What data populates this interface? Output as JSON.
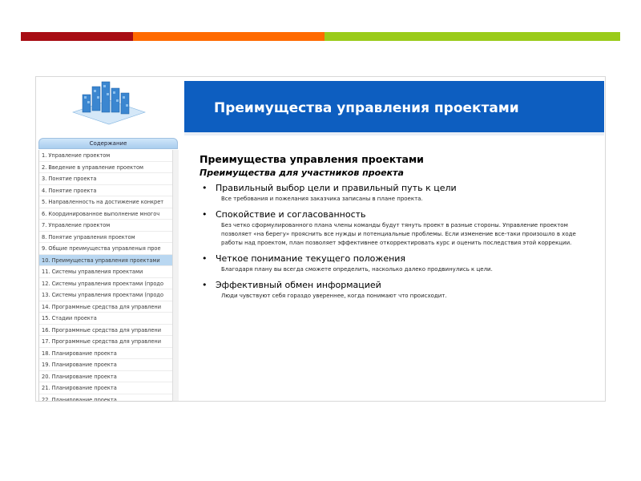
{
  "stripe_colors": [
    "#a80d14",
    "#ff6a00",
    "#9acb1a"
  ],
  "sidebar": {
    "toc_title": "Содержание",
    "items": [
      "1. Управление проектом",
      "2. Введение в управление проектом",
      "3. Понятие проекта",
      "4. Понятие проекта",
      "5. Направленность на достижение конкрет",
      "6. Координированное выполнение многоч",
      "7. Управление проектом",
      "8. Понятие управления проектом",
      "9. Общие преимущества управленыя прое",
      "10. Преимущества управления проектами",
      "11. Системы управления проектами",
      "12. Системы управления проектами (продо",
      "13. Системы управления проектами (продо",
      "14. Программные средства для управлени",
      "15. Стадии проекта",
      "16. Программные средства для управлени",
      "17. Программные средства для управлени",
      "18. Планирование проекта",
      "19. Планирование проекта",
      "20. Планирование проекта",
      "21. Планирование проекта",
      "22. Планирование проекта"
    ],
    "active_index": 9
  },
  "main": {
    "banner_title": "Преимущества управления проектами",
    "content_title": "Преимущества управления проектами",
    "content_subtitle": "Преимущества для участников проекта",
    "bullets": [
      {
        "title": "Правильный выбор цели и правильный путь к цели",
        "text": "Все требования и пожелания заказчика записаны в плане проекта."
      },
      {
        "title": "Спокойствие и согласованность",
        "text": "Без четко сформулированного плана члены команды будут тянуть проект в разные стороны. Управление проектом позволяет «на берегу» прояснить все нужды и потенциальные проблемы. Если изменение все-таки произошло в ходе работы над проектом, план позволяет эффективнее откорректировать курс и оценить последствия этой коррекции."
      },
      {
        "title": "Четкое понимание текущего положения",
        "text": "Благодаря плану вы всегда сможете определить, насколько далеко продвинулись к цели."
      },
      {
        "title": "Эффективный обмен информацией",
        "text": "Люди чувствуют себя гораздо увереннее, когда понимают что происходит."
      }
    ]
  },
  "colors": {
    "banner": "#0d5ec0",
    "active_item": "#b9d7f1"
  },
  "icons": {
    "logo": "isometric-blue-blocks-logo",
    "bullet": "bullet-dot"
  }
}
